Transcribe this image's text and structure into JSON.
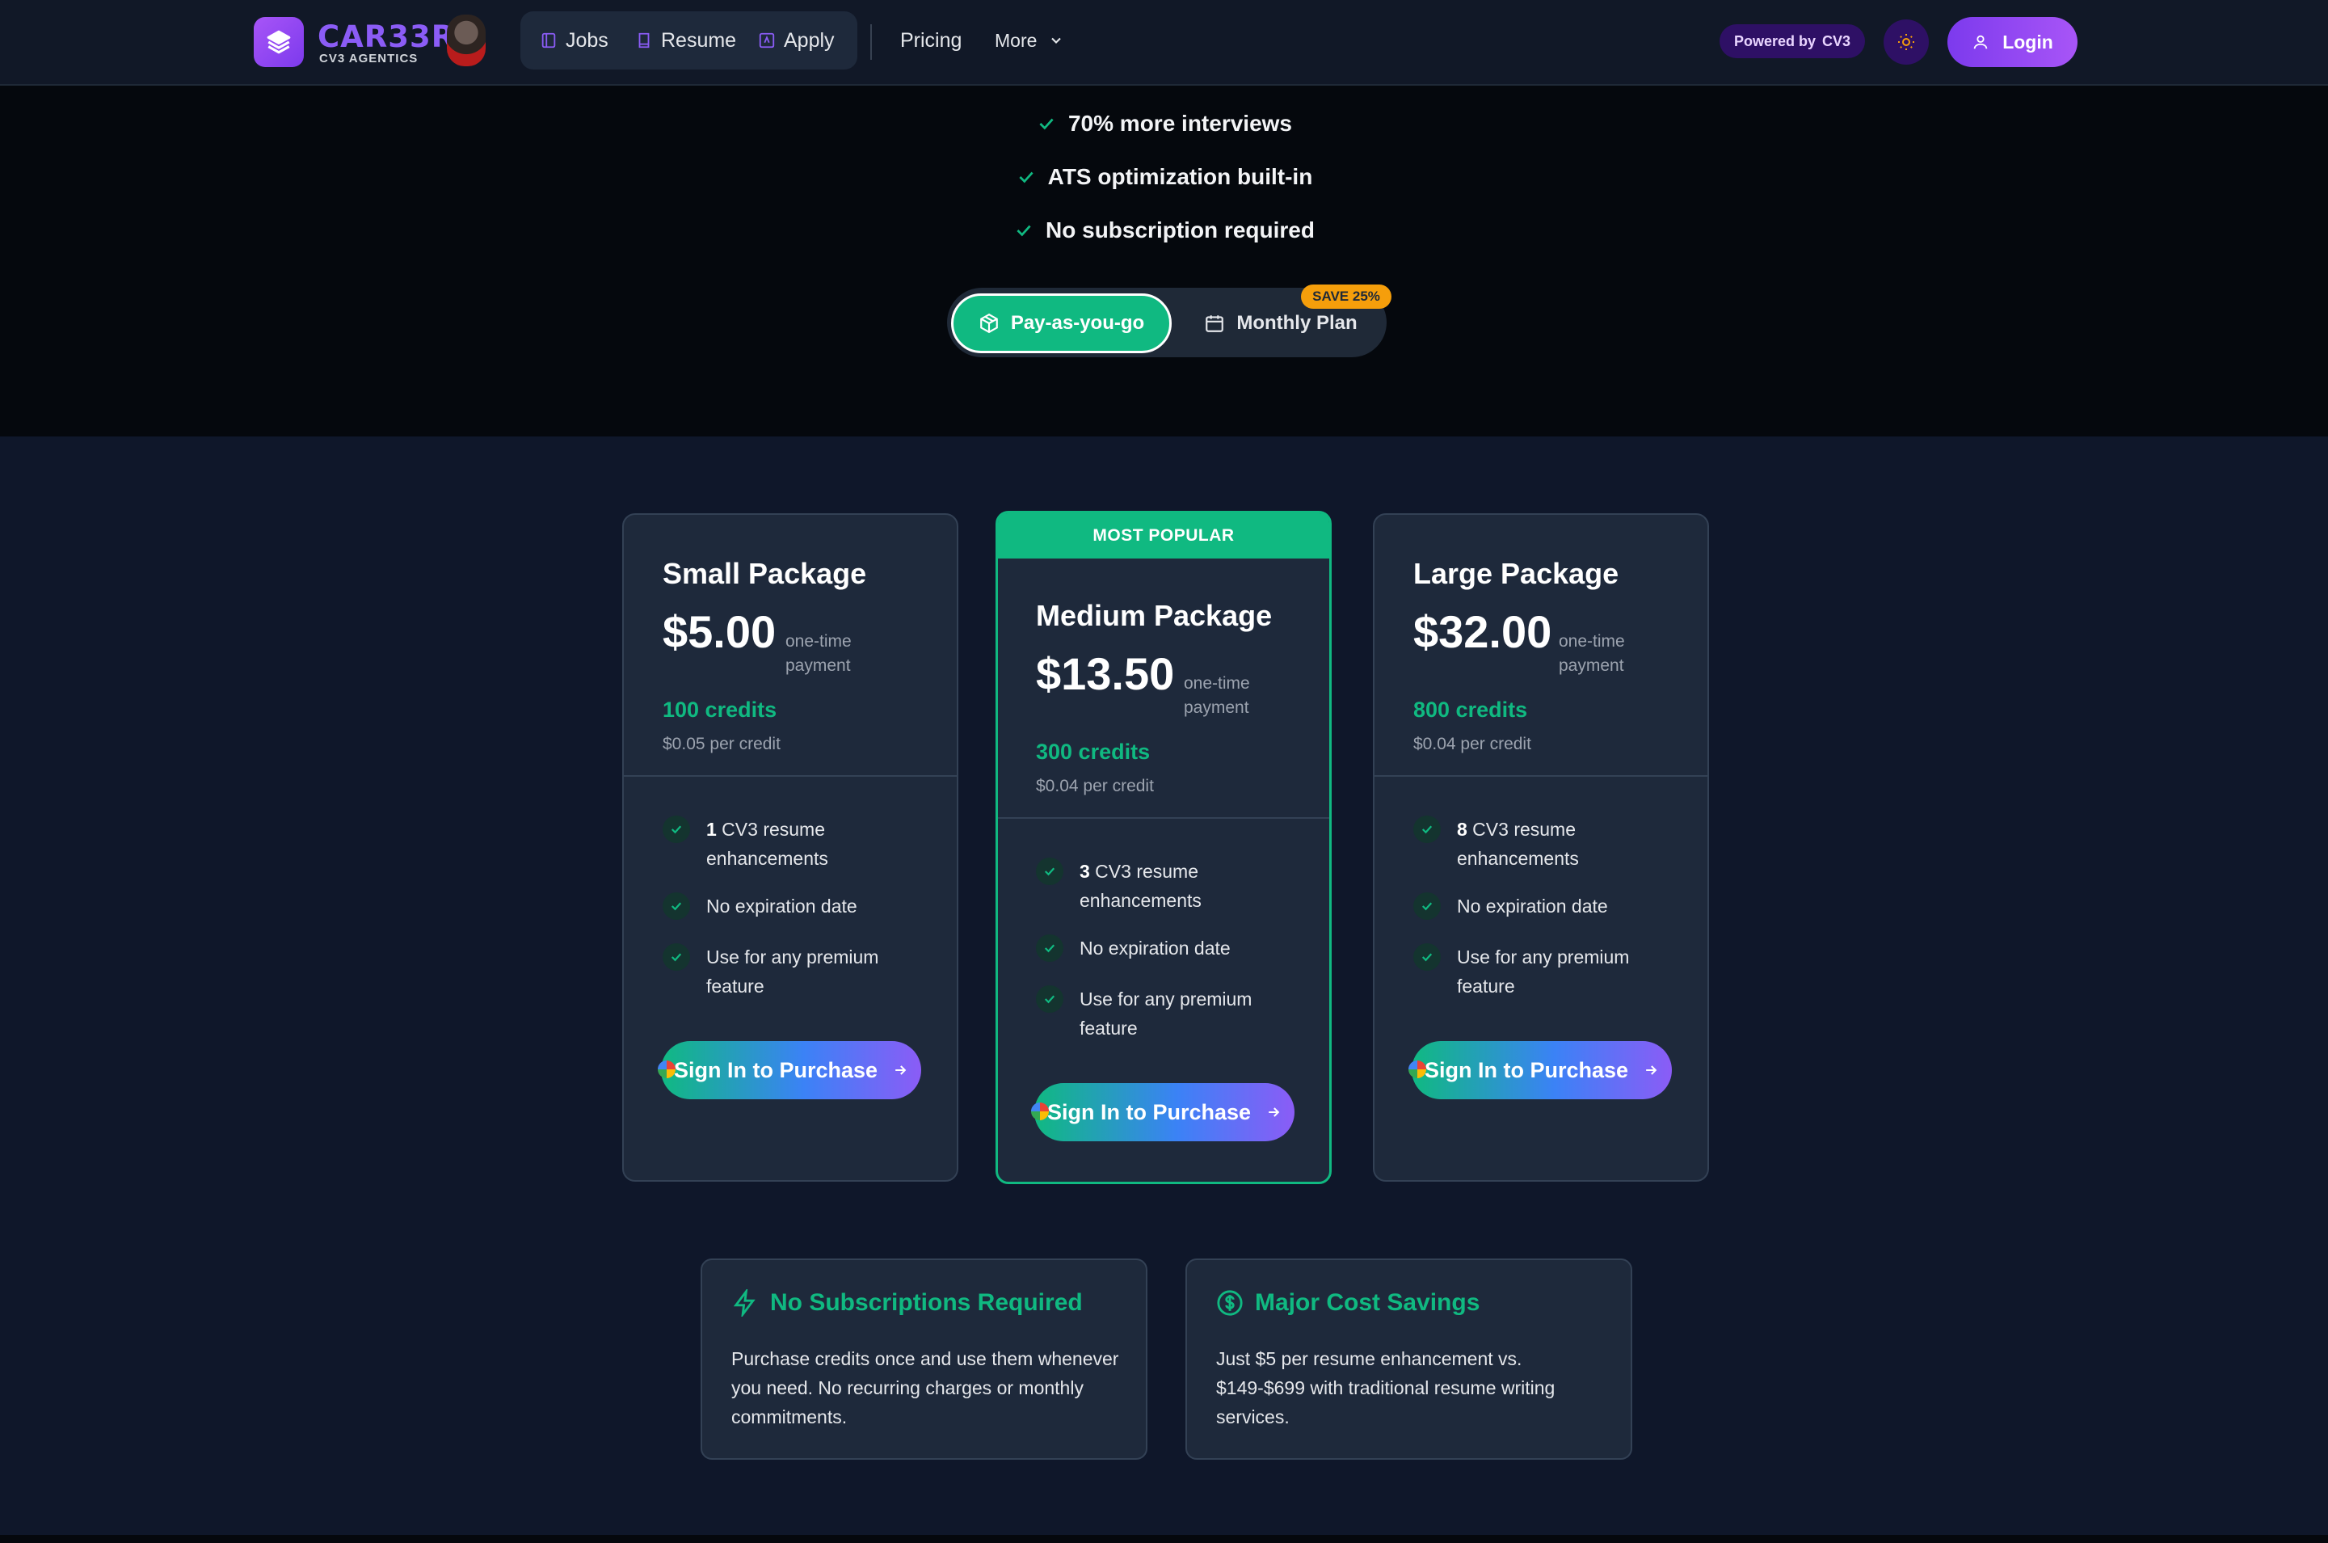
{
  "nav": {
    "brand": "CAR33R",
    "brand_sub": "CV3 AGENTICS",
    "items": [
      {
        "label": "Jobs",
        "icon": "book-icon"
      },
      {
        "label": "Resume",
        "icon": "bookmark-icon"
      },
      {
        "label": "Apply",
        "icon": "sparkle-square-icon"
      }
    ],
    "pricing": "Pricing",
    "more": "More",
    "powered_prefix": "Powered by",
    "powered_brand": "CV3",
    "login": "Login"
  },
  "hero": {
    "benefits": [
      "70% more interviews",
      "ATS optimization built-in",
      "No subscription required"
    ],
    "toggle_active": "Pay-as-you-go",
    "toggle_inactive": "Monthly Plan",
    "save_badge": "SAVE 25%"
  },
  "packages": [
    {
      "name": "Small Package",
      "price": "$5.00",
      "note": "one-time payment",
      "credits": "100 credits",
      "per_credit": "$0.05 per credit",
      "features": [
        {
          "bold": "1",
          "text": " CV3 resume enhancements"
        },
        {
          "bold": "",
          "text": "No expiration date"
        },
        {
          "bold": "",
          "text": "Use for any premium feature"
        }
      ],
      "button": "Sign In to Purchase"
    },
    {
      "name": "Medium Package",
      "price": "$13.50",
      "note": "one-time payment",
      "credits": "300 credits",
      "per_credit": "$0.04 per credit",
      "badge": "MOST POPULAR",
      "features": [
        {
          "bold": "3",
          "text": " CV3 resume enhancements"
        },
        {
          "bold": "",
          "text": "No expiration date"
        },
        {
          "bold": "",
          "text": "Use for any premium feature"
        }
      ],
      "button": "Sign In to Purchase"
    },
    {
      "name": "Large Package",
      "price": "$32.00",
      "note": "one-time payment",
      "credits": "800 credits",
      "per_credit": "$0.04 per credit",
      "features": [
        {
          "bold": "8",
          "text": " CV3 resume enhancements"
        },
        {
          "bold": "",
          "text": "No expiration date"
        },
        {
          "bold": "",
          "text": "Use for any premium feature"
        }
      ],
      "button": "Sign In to Purchase"
    }
  ],
  "info": [
    {
      "title": "No Subscriptions Required",
      "icon": "lightning-icon",
      "body": "Purchase credits once and use them whenever you need. No recurring charges or monthly commitments."
    },
    {
      "title": "Major Cost Savings",
      "icon": "dollar-circle-icon",
      "body": "Just $5 per resume enhancement vs. $149-$699 with traditional resume writing services."
    }
  ],
  "colors": {
    "accent": "#10b981",
    "brand": "#8b5cf6",
    "background": "#0f172a",
    "card": "#1e293b",
    "badge": "#f59e0b"
  }
}
